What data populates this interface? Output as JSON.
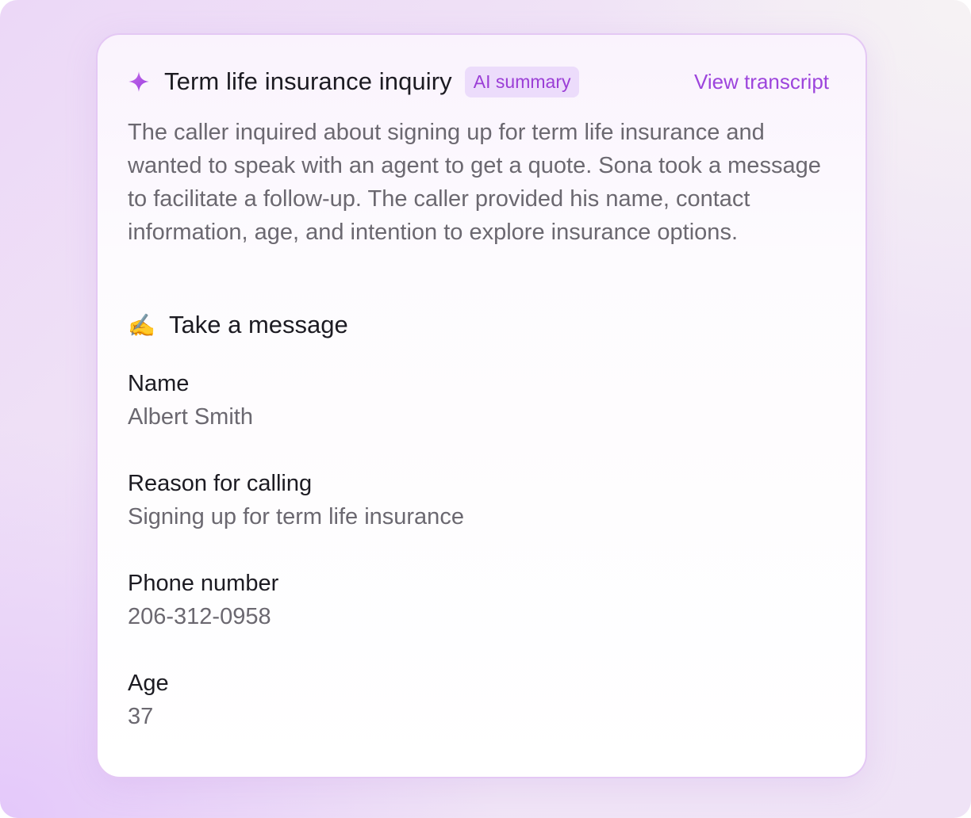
{
  "card": {
    "title": "Term life insurance inquiry",
    "badge": "AI summary",
    "transcript_link": "View transcript",
    "summary": "The caller inquired about signing up for term life insurance and wanted to speak with an agent to get a quote. Sona took a message to facilitate a follow-up. The caller provided his name, contact information, age, and intention to explore insurance options.",
    "section": {
      "emoji": "✍️",
      "title": "Take a message"
    },
    "fields": [
      {
        "label": "Name",
        "value": "Albert Smith"
      },
      {
        "label": "Reason for calling",
        "value": "Signing up for term life insurance"
      },
      {
        "label": "Phone number",
        "value": "206-312-0958"
      },
      {
        "label": "Age",
        "value": "37"
      }
    ]
  },
  "colors": {
    "accent": "#9d45dc",
    "badge_bg": "#ecdcfb",
    "title_text": "#1c1b22",
    "muted_text": "#6b6870"
  },
  "icons": {
    "header": "sparkle-icon",
    "section": "writing-hand-icon"
  }
}
